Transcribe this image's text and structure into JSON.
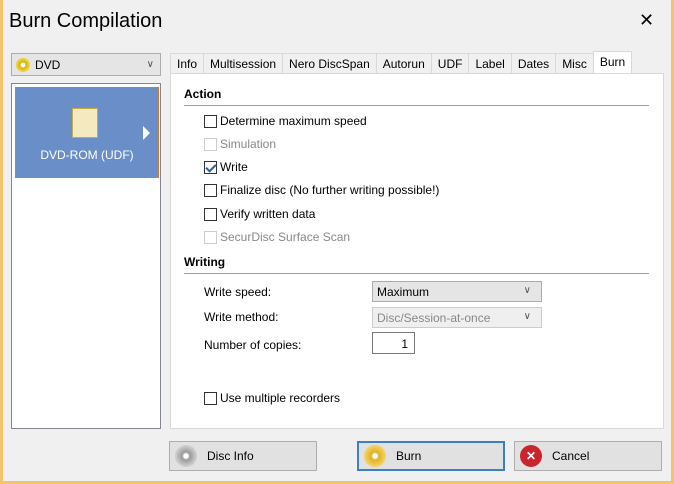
{
  "window": {
    "title": "Burn Compilation",
    "close": "✕"
  },
  "disc_type": {
    "value": "DVD"
  },
  "compilation": {
    "label": "DVD-ROM (UDF)"
  },
  "tabs": [
    "Info",
    "Multisession",
    "Nero DiscSpan",
    "Autorun",
    "UDF",
    "Label",
    "Dates",
    "Misc",
    "Burn"
  ],
  "action": {
    "title": "Action",
    "options": [
      {
        "label": "Determine maximum speed",
        "checked": false,
        "enabled": true
      },
      {
        "label": "Simulation",
        "checked": false,
        "enabled": false
      },
      {
        "label": "Write",
        "checked": true,
        "enabled": true
      },
      {
        "label": "Finalize disc (No further writing possible!)",
        "checked": false,
        "enabled": true
      },
      {
        "label": "Verify written data",
        "checked": false,
        "enabled": true
      },
      {
        "label": "SecurDisc Surface Scan",
        "checked": false,
        "enabled": false
      }
    ]
  },
  "writing": {
    "title": "Writing",
    "speed_label": "Write speed:",
    "speed": "Maximum",
    "method_label": "Write method:",
    "method": "Disc/Session-at-once",
    "copies_label": "Number of copies:",
    "copies": "1",
    "multi": "Use multiple recorders"
  },
  "buttons": {
    "disc_info": "Disc Info",
    "burn": "Burn",
    "cancel": "Cancel"
  }
}
